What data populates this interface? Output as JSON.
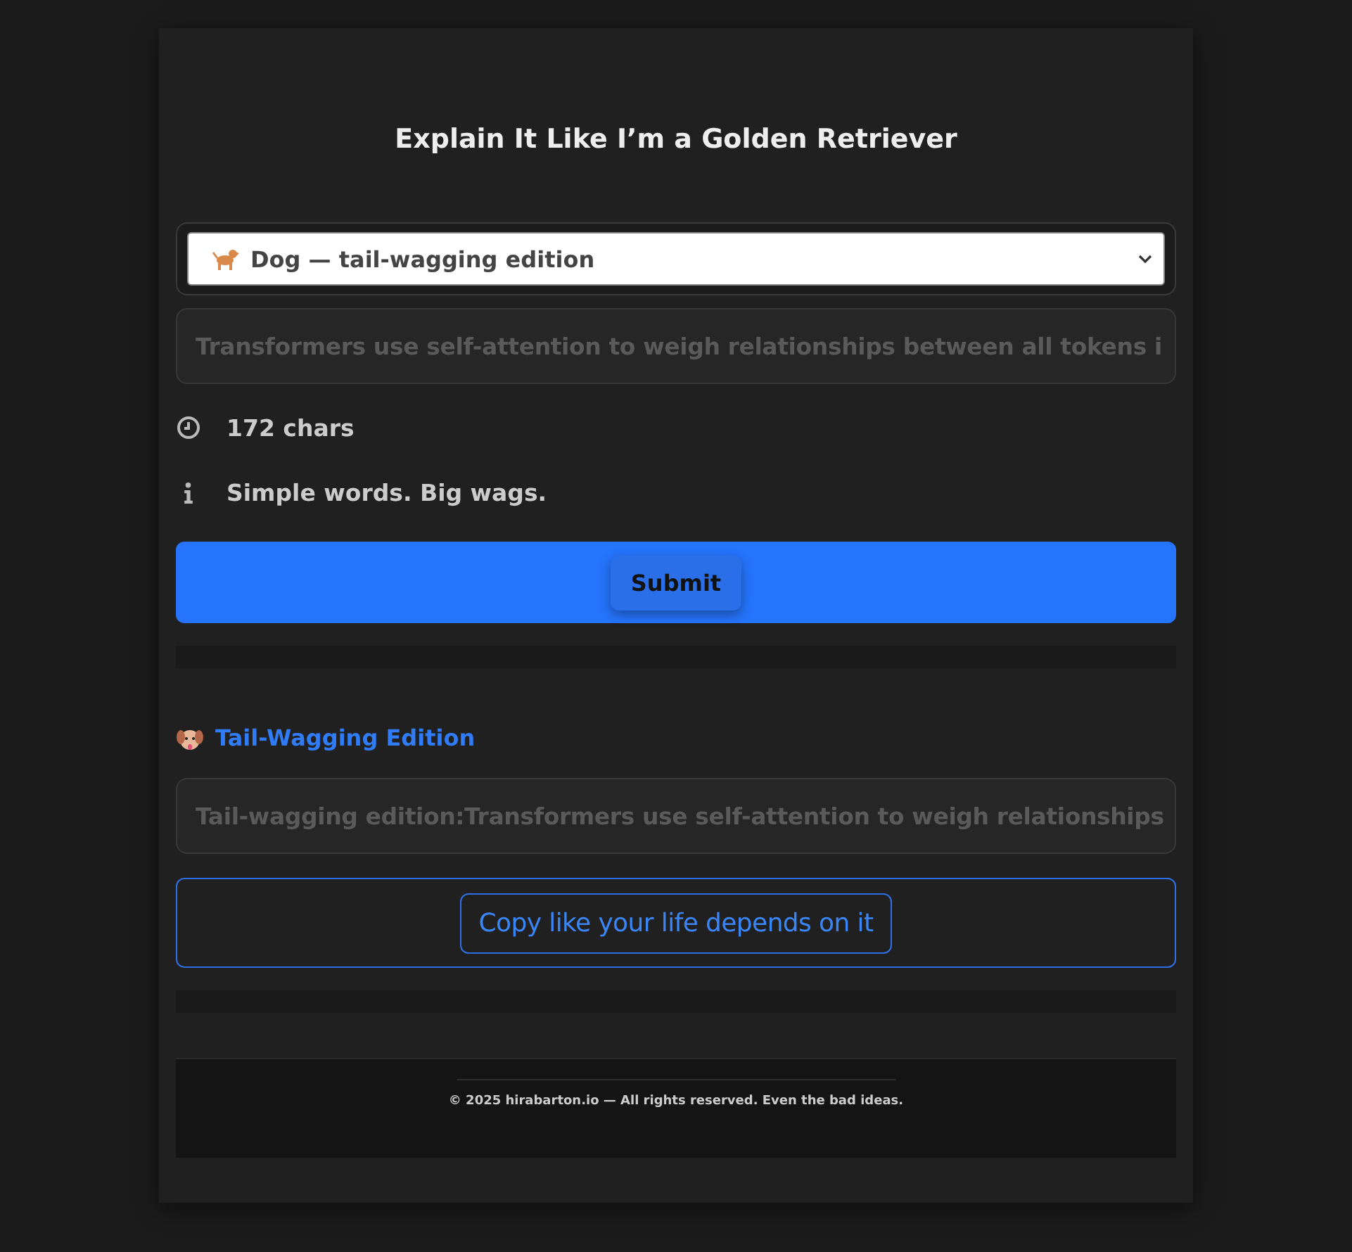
{
  "title": "Explain It Like I’m a Golden Retriever",
  "mode_select": {
    "value": "Dog — tail-wagging edition"
  },
  "input": {
    "value": "Transformers use self-attention to weigh relationships between all tokens i"
  },
  "stats": [
    {
      "kind": "clock",
      "text": "172 chars"
    },
    {
      "kind": "info",
      "text": "Simple words. Big wags."
    }
  ],
  "submit": "Submit",
  "result": {
    "heading": "Tail-Wagging Edition",
    "output": "Tail-wagging edition:Transformers use self-attention to weigh relationships",
    "copy": "Copy like your life depends on it"
  },
  "footer": "© 2025 hirabarton.io — All rights reserved. Even the bad ideas."
}
